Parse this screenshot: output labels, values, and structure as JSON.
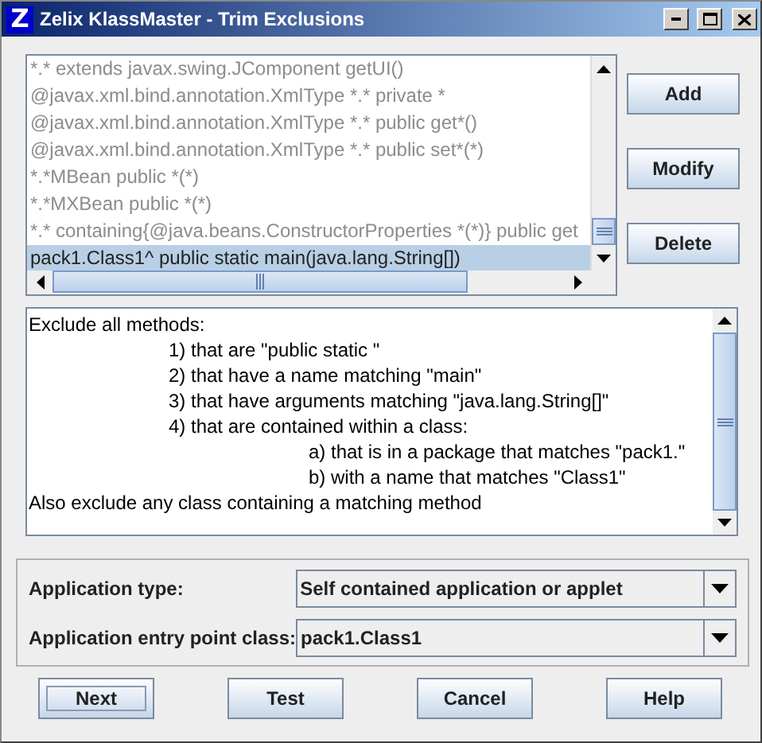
{
  "window": {
    "title": "Zelix KlassMaster - Trim Exclusions",
    "logo": "Z"
  },
  "exclusions": [
    {
      "text": "*.* extends javax.swing.JComponent getUI()",
      "greyed": true,
      "selected": false
    },
    {
      "text": "@javax.xml.bind.annotation.XmlType *.* private *",
      "greyed": true,
      "selected": false
    },
    {
      "text": "@javax.xml.bind.annotation.XmlType *.* public get*()",
      "greyed": true,
      "selected": false
    },
    {
      "text": "@javax.xml.bind.annotation.XmlType *.* public set*(*)",
      "greyed": true,
      "selected": false
    },
    {
      "text": "*.*MBean public *(*)",
      "greyed": true,
      "selected": false
    },
    {
      "text": "*.*MXBean public *(*)",
      "greyed": true,
      "selected": false
    },
    {
      "text": "*.* containing{@java.beans.ConstructorProperties *(*)} public get",
      "greyed": true,
      "selected": false
    },
    {
      "text": "pack1.Class1^ public static main(java.lang.String[])",
      "greyed": false,
      "selected": true
    }
  ],
  "side_buttons": [
    "Add",
    "Modify",
    "Delete"
  ],
  "description": [
    {
      "text": "Exclude all methods:",
      "children": [
        {
          "text": "1) that are \"public static \""
        },
        {
          "text": "2) that have a name matching \"main\""
        },
        {
          "text": "3) that have arguments matching \"java.lang.String[]\""
        },
        {
          "text": "4) that are contained within a class:",
          "children": [
            {
              "text": "a) that is in a package that matches \"pack1.\""
            },
            {
              "text": "b) with a name that matches \"Class1\""
            }
          ]
        }
      ]
    },
    {
      "text": "Also exclude any class containing a matching method"
    }
  ],
  "settings": [
    {
      "label": "Application type:",
      "value": "Self contained application or applet"
    },
    {
      "label": "Application entry point class:",
      "value": "pack1.Class1"
    }
  ],
  "buttons": [
    {
      "label": "Next",
      "focused": true
    },
    {
      "label": "Test",
      "focused": false
    },
    {
      "label": "Cancel",
      "focused": false
    },
    {
      "label": "Help",
      "focused": false
    }
  ]
}
